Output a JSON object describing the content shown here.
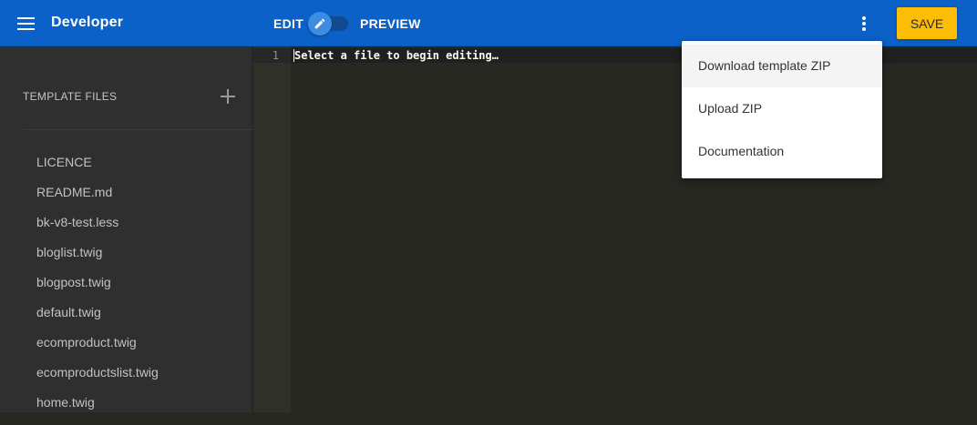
{
  "header": {
    "title": "Developer",
    "mode_edit_label": "EDIT",
    "mode_preview_label": "PREVIEW",
    "mode_selected": "edit",
    "save_label": "SAVE",
    "accent_color": "#0b61c7",
    "save_color": "#fcbd07"
  },
  "sidebar": {
    "header": "TEMPLATE FILES",
    "files": [
      "LICENCE",
      "README.md",
      "bk-v8-test.less",
      "bloglist.twig",
      "blogpost.twig",
      "default.twig",
      "ecomproduct.twig",
      "ecomproductslist.twig",
      "home.twig"
    ]
  },
  "editor": {
    "line_number": "1",
    "placeholder_text": "Select a file to begin editing…"
  },
  "menu": {
    "items": [
      "Download template ZIP",
      "Upload ZIP",
      "Documentation"
    ],
    "highlighted_index": 0
  },
  "icons": {
    "menu": "hamburger-menu-icon",
    "toggle": "pencil-icon",
    "more": "more-vertical-icon",
    "add": "plus-icon"
  }
}
